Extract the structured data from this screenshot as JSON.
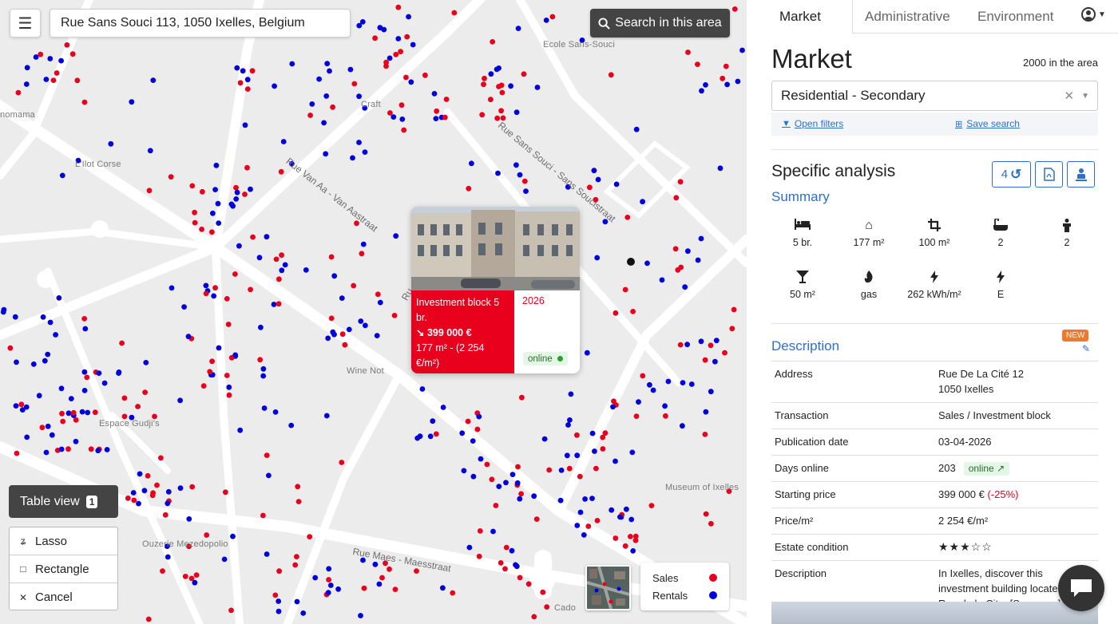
{
  "map": {
    "search_value": "Rue Sans Souci 113, 1050 Ixelles, Belgium",
    "search_area_label": "Search in this area",
    "place_labels": [
      "Ecole Sans-Souci",
      "Craft",
      "L'Ilot Corse",
      "Espace Gudji's",
      "Wine Not",
      "Ouzerie Mezedopolio",
      "Museum of Ixelles",
      "Cado",
      "nomama"
    ],
    "street_labels": [
      "Rue Van Aa - Van Aastraat",
      "Rue Sans Souci - Sans Soucistraat",
      "Rue Maes - Maesstraat",
      "Ru"
    ],
    "popup": {
      "title": "Investment block 5 br.",
      "price": "↘ 399 000 €",
      "area_line": "177 m² - (2 254 €/m²)",
      "year": "2026",
      "status": "online"
    },
    "table_view_label": "Table view",
    "table_view_count": "1",
    "tools": [
      {
        "icon": "lasso-icon",
        "label": "Lasso"
      },
      {
        "icon": "rectangle-icon",
        "label": "Rectangle"
      },
      {
        "icon": "cancel-icon",
        "label": "Cancel"
      }
    ],
    "legend": [
      {
        "label": "Sales",
        "color": "#e8001c"
      },
      {
        "label": "Rentals",
        "color": "#0000dd"
      }
    ]
  },
  "panel": {
    "tabs": [
      "Market",
      "Administrative",
      "Environment"
    ],
    "title": "Market",
    "area_count": "2000 in the area",
    "selected_type": "Residential - Secondary",
    "open_filters": "Open filters",
    "save_search": "Save search",
    "specific_analysis": "Specific analysis",
    "history_count": "4",
    "summary_title": "Summary",
    "features": [
      {
        "icon": "bed-icon",
        "value": "5 br."
      },
      {
        "icon": "home-icon",
        "value": "177 m²"
      },
      {
        "icon": "crop-icon",
        "value": "100 m²"
      },
      {
        "icon": "bath-icon",
        "value": "2"
      },
      {
        "icon": "person-icon",
        "value": "2"
      },
      {
        "icon": "funnel-icon",
        "value": "50 m²"
      },
      {
        "icon": "flame-icon",
        "value": "gas"
      },
      {
        "icon": "bolt-icon",
        "value": "262 kWh/m²"
      },
      {
        "icon": "bolt-icon",
        "value": "E"
      }
    ],
    "description_title": "Description",
    "new_badge": "NEW",
    "rows": {
      "address_label": "Address",
      "address_line1": "Rue De La Cité 12",
      "address_line2": "1050 Ixelles",
      "transaction_label": "Transaction",
      "transaction_value": "Sales / Investment block",
      "publication_label": "Publication date",
      "publication_value": "03-04-2026",
      "days_label": "Days online",
      "days_value": "203",
      "days_status": "online",
      "starting_label": "Starting price",
      "starting_value": "399 000 €",
      "starting_change": "(-25%)",
      "ppm_label": "Price/m²",
      "ppm_value": "2 254 €/m²",
      "condition_label": "Estate condition",
      "condition_stars": "★★★☆☆",
      "description_label": "Description",
      "description_value": "In Ixelles, discover this investment building located at Rue de la Cit... [See more]"
    }
  },
  "colors": {
    "sales": "#e8001c",
    "rentals": "#0000dd",
    "accent": "#2b6fd1"
  }
}
